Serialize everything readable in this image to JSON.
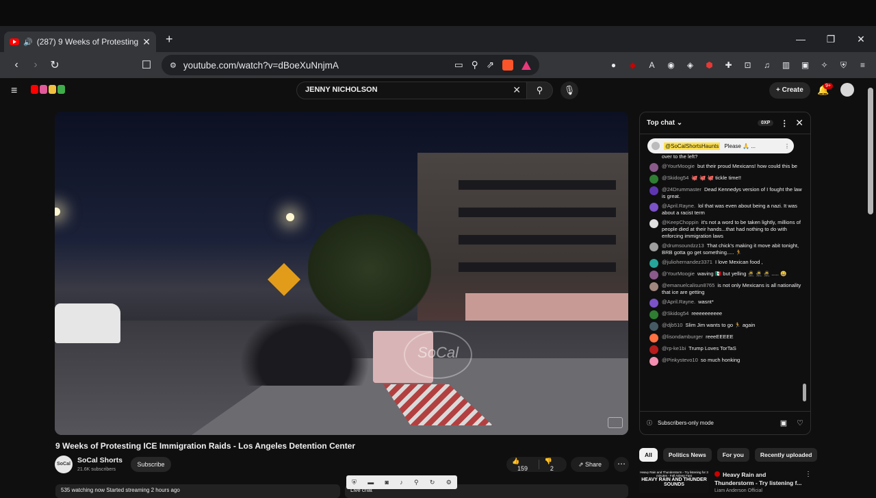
{
  "browser": {
    "tab_title": "(287) 9 Weeks of Protesting I",
    "url": "youtube.com/watch?v=dBoeXuNnjmA",
    "window_controls": [
      "—",
      "❐",
      "✕"
    ]
  },
  "youtube": {
    "search_query": "JENNY NICHOLSON",
    "create_label": "Create",
    "notification_badge": "9+"
  },
  "video": {
    "title": "9 Weeks of Protesting ICE Immigration Raids - Los Angeles Detention Center",
    "channel": "SoCal Shorts",
    "channel_avatar_text": "SoCal",
    "subscribers": "21.6K subscribers",
    "subscribe_label": "Subscribe",
    "likes": "159",
    "dislikes": "2",
    "share_label": "Share",
    "watermark": "SoCal",
    "description_preview": "535 watching now  Started streaming 2 hours ago",
    "live_chat_label": "Live chat"
  },
  "chat": {
    "mode": "Top chat",
    "xp": "0XP",
    "pinned_user": "@SoCalShortsHaunts",
    "pinned_text": "Please 🙏 ...",
    "partial_top": "over to the left?",
    "messages": [
      {
        "user": "@YourMoogie",
        "text": "but their proud Mexicans! how could this be",
        "color": "#8a5a8a"
      },
      {
        "user": "@Skidog54",
        "text": "🐙 🐙 🐙 tickle time!!",
        "color": "#2e7d32"
      },
      {
        "user": "@24Drummaster",
        "text": "Dead Kennedys version of I fought the law is great.",
        "color": "#5e35b1"
      },
      {
        "user": "@April.Rayne.",
        "text": "lol that was even about being a nazi. It was about a racist term",
        "color": "#7b52c7"
      },
      {
        "user": "@KeepChoppin",
        "text": "it's not a word to be taken lightly, millions of people died at their hands...that had nothing to do with enforcing immigration laws",
        "color": "#e0e0e0"
      },
      {
        "user": "@drumsoundzz13",
        "text": "That chick's making it move abit tonight, BRB gotta go get something..... 🏃",
        "color": "#9e9e9e"
      },
      {
        "user": "@juliohernandez3371",
        "text": "I love Mexican food ,",
        "color": "#26a69a"
      },
      {
        "user": "@YourMoogie",
        "text": "waving 🇲🇽 but yelling 🥷 🥷 🥷 ..... 😄",
        "color": "#8a5a8a"
      },
      {
        "user": "@emanuelcalisun8765",
        "text": "is not only Mexicans is all nationality that ice are getting",
        "color": "#a1887f"
      },
      {
        "user": "@April.Rayne.",
        "text": "wasnt*",
        "color": "#7b52c7"
      },
      {
        "user": "@Skidog54",
        "text": "reeeeeeeeee",
        "color": "#2e7d32"
      },
      {
        "user": "@djb510",
        "text": "Slim Jim wants to go 🏃 again",
        "color": "#455a64"
      },
      {
        "user": "@lisondamburger",
        "text": "reeeEEEEE",
        "color": "#ff7043"
      },
      {
        "user": "@rp-ke1bi",
        "text": "Trump Loves TorTaS",
        "color": "#b71c1c"
      },
      {
        "user": "@Pinkystevo10",
        "text": "so much honking",
        "color": "#f48fb1"
      }
    ],
    "footer_label": "Subscribers-only mode"
  },
  "chips": [
    "All",
    "Politics News",
    "For you",
    "Recently uploaded"
  ],
  "recommendation": {
    "thumb_text": "HEAVY RAIN AND THUNDER SOUNDS",
    "thumb_caption": "Heavy Rain and Thunderstorm - Try listening for 3 minutes - Fall Asleep Fast",
    "title": "Heavy Rain and Thunderstorm - Try listening f...",
    "channel": "Liam Anderson Official"
  }
}
